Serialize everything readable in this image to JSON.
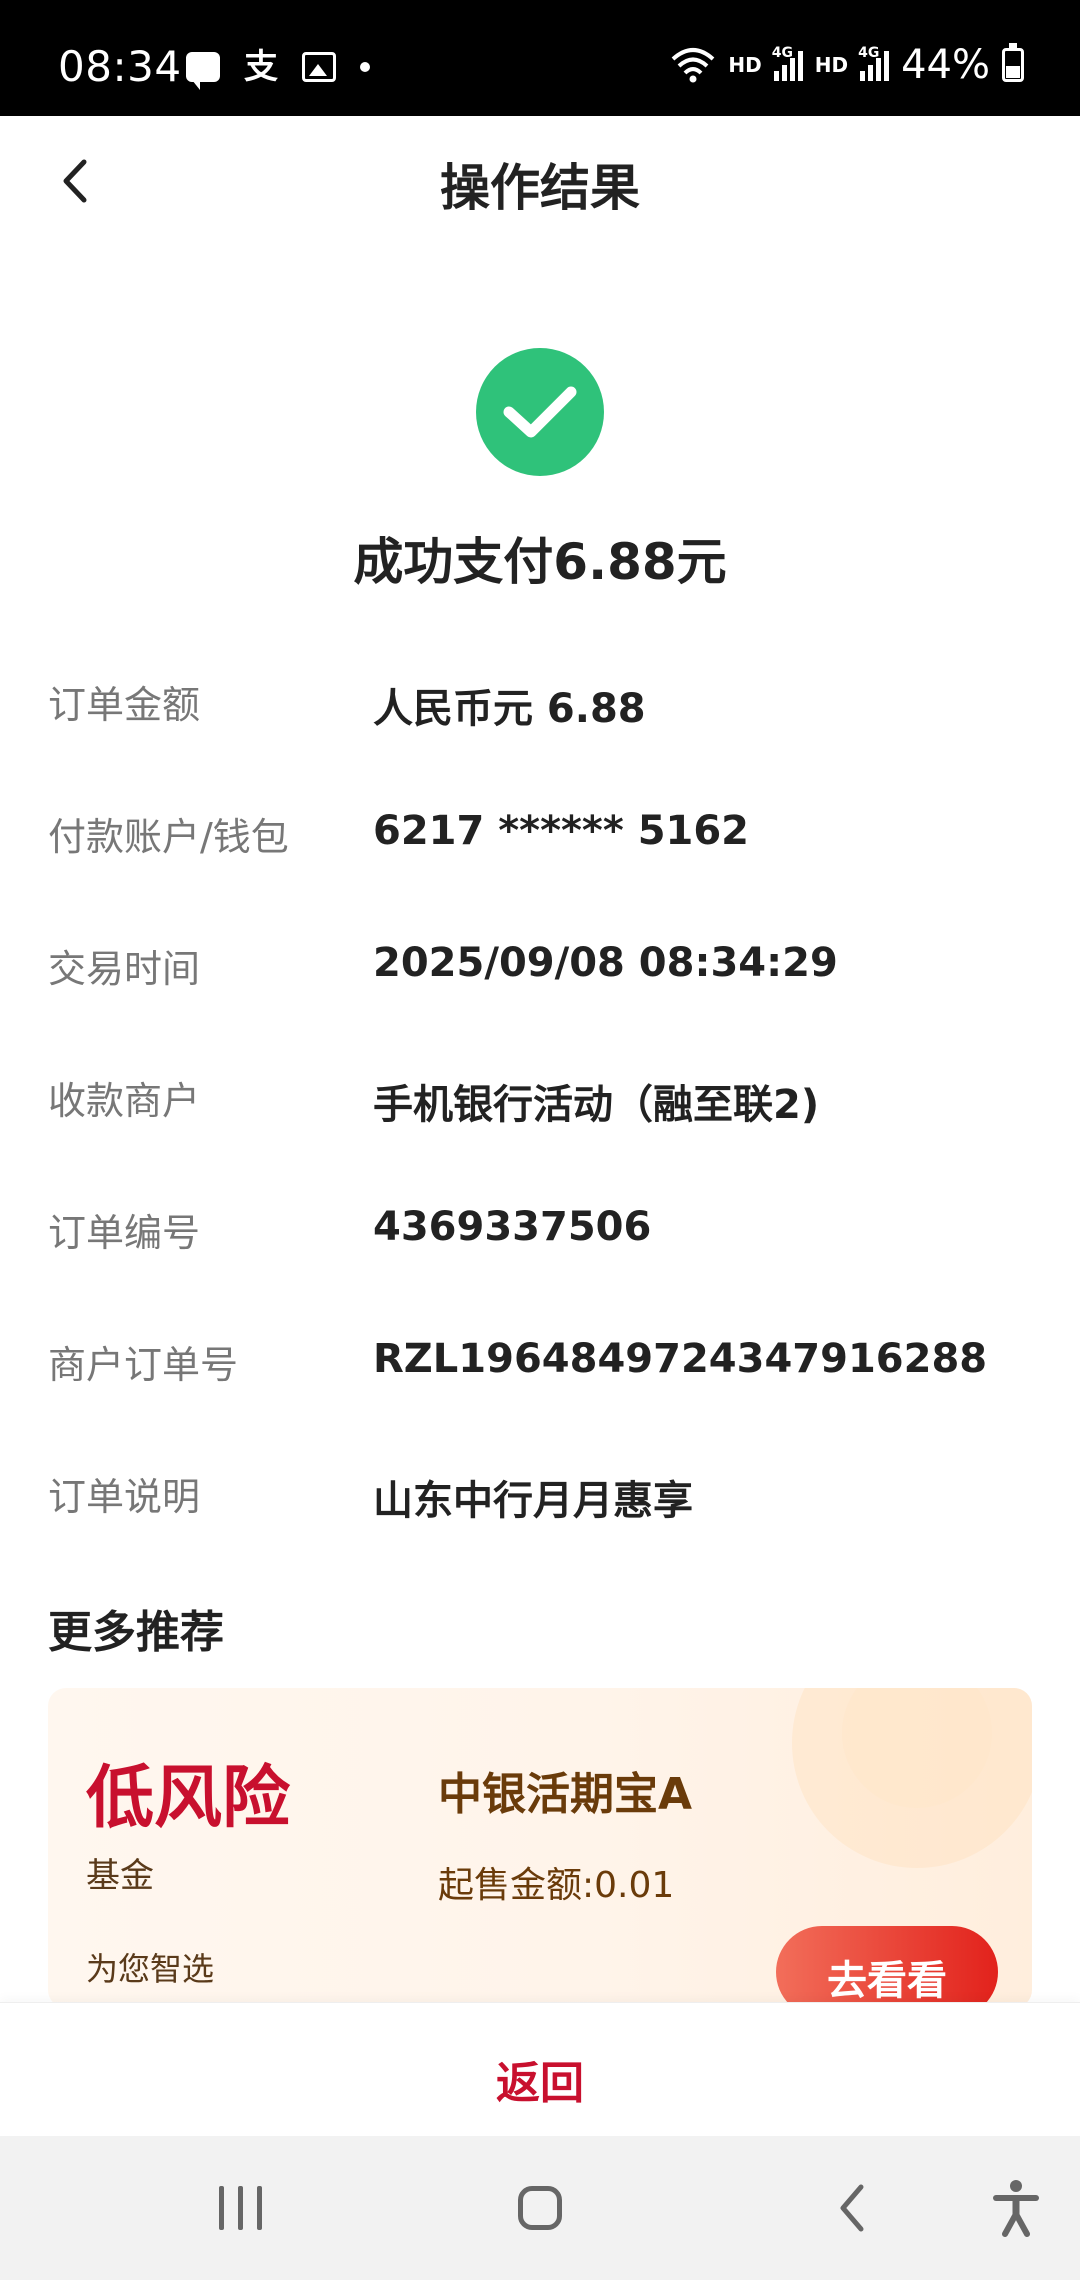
{
  "status_bar": {
    "time": "08:34",
    "notification_icons": [
      "message-icon",
      "alipay-icon",
      "image-icon",
      "dot-icon"
    ],
    "hd_label_1": "HD",
    "net_label_1": "4G",
    "hd_label_2": "HD",
    "net_label_2": "4G",
    "battery": "44%"
  },
  "header": {
    "title": "操作结果",
    "back_icon": "chevron-left-icon"
  },
  "result": {
    "icon": "check-circle-icon",
    "status_color": "#2fc27a",
    "title": "成功支付6.88元"
  },
  "details": [
    {
      "label": "订单金额",
      "value": "人民币元 6.88"
    },
    {
      "label": "付款账户/钱包",
      "value": "6217 ****** 5162"
    },
    {
      "label": "交易时间",
      "value": "2025/09/08 08:34:29"
    },
    {
      "label": "收款商户",
      "value": "手机银行活动（融至联2)"
    },
    {
      "label": "订单编号",
      "value": "4369337506"
    },
    {
      "label": "商户订单号",
      "value": "RZL1964849724347916288"
    },
    {
      "label": "订单说明",
      "value": "山东中行月月惠享"
    }
  ],
  "recommend": {
    "title": "更多推荐",
    "card": {
      "risk_label": "低风险",
      "fund_type": "基金",
      "pick_label": "为您智选",
      "product_name": "中银活期宝A",
      "min_amount": "起售金额:0.01",
      "button_label": "去看看"
    }
  },
  "footer": {
    "return_label": "返回",
    "accent_color": "#c8102e"
  },
  "nav_bar": {
    "icons": [
      "recent-apps-icon",
      "home-icon",
      "back-icon",
      "accessibility-icon"
    ]
  }
}
